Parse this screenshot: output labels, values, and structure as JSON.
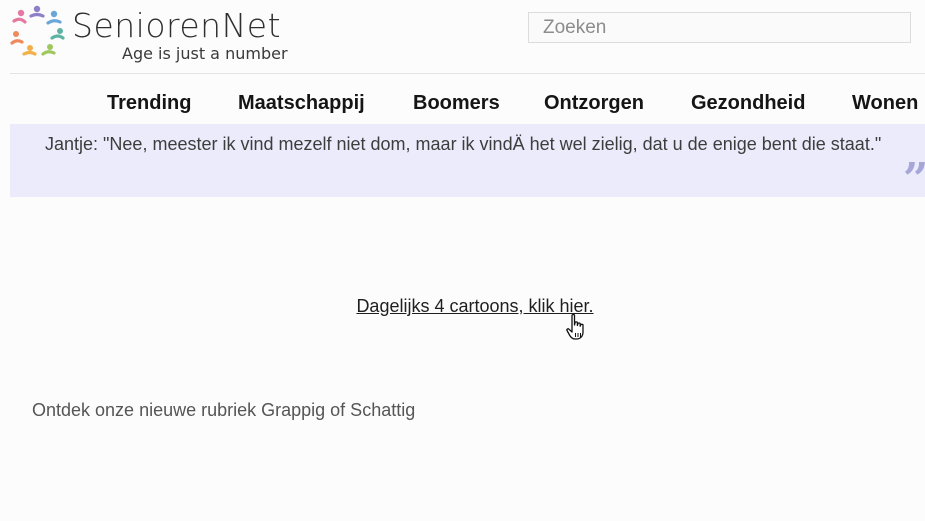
{
  "header": {
    "logo_name": "SeniorenNet",
    "logo_tagline": "Age is just a number",
    "search_placeholder": "Zoeken"
  },
  "nav": {
    "items": [
      {
        "label": "Trending"
      },
      {
        "label": "Maatschappij"
      },
      {
        "label": "Boomers"
      },
      {
        "label": "Ontzorgen"
      },
      {
        "label": "Gezondheid"
      },
      {
        "label": "Wonen"
      }
    ]
  },
  "quote": {
    "text": "Jantje: \"Nee, meester ik vind mezelf niet dom, maar ik vindÄ het wel zielig, dat u de enige bent die staat.\"",
    "mark": "”"
  },
  "content": {
    "cartoon_link": "Dagelijks 4 cartoons, klik hier.",
    "promo_text": "Ontdek onze nieuwe rubriek Grappig of Schattig"
  },
  "colors": {
    "quote_background": "#ecebfb",
    "quote_mark": "#a7a6d8"
  },
  "icons": {
    "logo": "seniorennet-logo-icon",
    "cursor": "hand-pointer-icon"
  }
}
